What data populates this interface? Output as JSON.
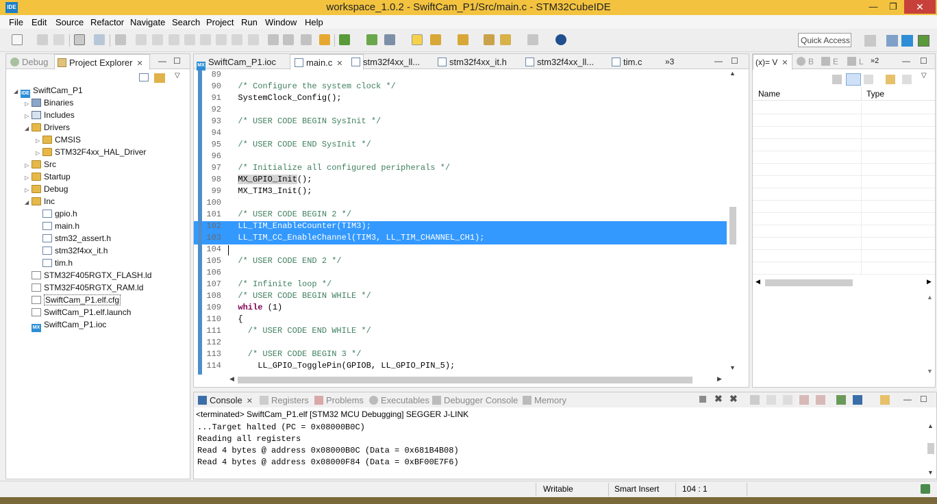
{
  "window": {
    "title": "workspace_1.0.2 - SwiftCam_P1/Src/main.c - STM32CubeIDE",
    "app_icon_text": "IDE",
    "min_glyph": "—",
    "max_glyph": "❐",
    "close_glyph": "✕"
  },
  "menu": [
    "File",
    "Edit",
    "Source",
    "Refactor",
    "Navigate",
    "Search",
    "Project",
    "Run",
    "Window",
    "Help"
  ],
  "toolbar": {
    "quick_access": "Quick Access"
  },
  "left_panel": {
    "tabs": [
      {
        "label": "Debug",
        "icon": "debug-icon"
      },
      {
        "label": "Project Explorer",
        "icon": "project-explorer-icon",
        "close": "✕"
      }
    ],
    "tree": [
      {
        "label": "SwiftCam_P1",
        "icon": "project-icon",
        "arrow": "◢"
      },
      {
        "label": "Binaries",
        "icon": "binaries-icon",
        "arrow": "▷"
      },
      {
        "label": "Includes",
        "icon": "includes-icon",
        "arrow": "▷"
      },
      {
        "label": "Drivers",
        "icon": "folder-icon",
        "arrow": "◢"
      },
      {
        "label": "CMSIS",
        "icon": "folder-icon",
        "arrow": "▷"
      },
      {
        "label": "STM32F4xx_HAL_Driver",
        "icon": "folder-icon",
        "arrow": "▷"
      },
      {
        "label": "Src",
        "icon": "folder-icon",
        "arrow": "▷"
      },
      {
        "label": "Startup",
        "icon": "folder-icon",
        "arrow": "▷"
      },
      {
        "label": "Debug",
        "icon": "folder-icon",
        "arrow": "▷"
      },
      {
        "label": "Inc",
        "icon": "folder-icon",
        "arrow": "◢"
      },
      {
        "label": "gpio.h",
        "icon": "header-file-icon",
        "arrow": ""
      },
      {
        "label": "main.h",
        "icon": "header-file-icon",
        "arrow": ""
      },
      {
        "label": "stm32_assert.h",
        "icon": "header-file-icon",
        "arrow": ""
      },
      {
        "label": "stm32f4xx_it.h",
        "icon": "header-file-icon",
        "arrow": ""
      },
      {
        "label": "tim.h",
        "icon": "header-file-icon",
        "arrow": ""
      },
      {
        "label": "STM32F405RGTX_FLASH.ld",
        "icon": "linker-file-icon",
        "arrow": ""
      },
      {
        "label": "STM32F405RGTX_RAM.ld",
        "icon": "linker-file-icon",
        "arrow": ""
      },
      {
        "label": "SwiftCam_P1.elf.cfg",
        "icon": "cfg-file-icon",
        "arrow": ""
      },
      {
        "label": "SwiftCam_P1.elf.launch",
        "icon": "launch-file-icon",
        "arrow": ""
      },
      {
        "label": "SwiftCam_P1.ioc",
        "icon": "ioc-file-icon",
        "arrow": ""
      }
    ]
  },
  "editor": {
    "tabs": [
      {
        "label": "SwiftCam_P1.ioc",
        "icon": "ioc-file-icon"
      },
      {
        "label": "main.c",
        "icon": "c-file-icon",
        "close": "✕"
      },
      {
        "label": "stm32f4xx_ll...",
        "icon": "header-file-icon"
      },
      {
        "label": "stm32f4xx_it.h",
        "icon": "header-file-icon"
      },
      {
        "label": "stm32f4xx_ll...",
        "icon": "header-file-icon"
      },
      {
        "label": "tim.c",
        "icon": "c-file-icon"
      }
    ],
    "overflow_tabs": "»3",
    "lines": [
      {
        "n": "89",
        "t": "",
        "kind": ""
      },
      {
        "n": "90",
        "t": "  /* Configure the system clock */",
        "kind": "cmt"
      },
      {
        "n": "91",
        "t": "  SystemClock_Config();",
        "kind": ""
      },
      {
        "n": "92",
        "t": "",
        "kind": ""
      },
      {
        "n": "93",
        "t": "  /* USER CODE BEGIN SysInit */",
        "kind": "cmt"
      },
      {
        "n": "94",
        "t": "",
        "kind": ""
      },
      {
        "n": "95",
        "t": "  /* USER CODE END SysInit */",
        "kind": "cmt"
      },
      {
        "n": "96",
        "t": "",
        "kind": ""
      },
      {
        "n": "97",
        "t": "  /* Initialize all configured peripherals */",
        "kind": "cmt"
      },
      {
        "n": "98",
        "t": "  MX_GPIO_Init();",
        "kind": "hlcall"
      },
      {
        "n": "99",
        "t": "  MX_TIM3_Init();",
        "kind": ""
      },
      {
        "n": "100",
        "t": "",
        "kind": ""
      },
      {
        "n": "101",
        "t": "  /* USER CODE BEGIN 2 */",
        "kind": "cmt"
      },
      {
        "n": "102",
        "t": "  LL_TIM_EnableCounter(TIM3);",
        "kind": "sel"
      },
      {
        "n": "103",
        "t": "  LL_TIM_CC_EnableChannel(TIM3, LL_TIM_CHANNEL_CH1);",
        "kind": "sel"
      },
      {
        "n": "104",
        "t": "",
        "kind": "cursor"
      },
      {
        "n": "105",
        "t": "  /* USER CODE END 2 */",
        "kind": "cmt"
      },
      {
        "n": "106",
        "t": "",
        "kind": ""
      },
      {
        "n": "107",
        "t": "  /* Infinite loop */",
        "kind": "cmt"
      },
      {
        "n": "108",
        "t": "  /* USER CODE BEGIN WHILE */",
        "kind": "cmt"
      },
      {
        "n": "109",
        "t": "  while (1)",
        "kind": "kwline"
      },
      {
        "n": "110",
        "t": "  {",
        "kind": ""
      },
      {
        "n": "111",
        "t": "    /* USER CODE END WHILE */",
        "kind": "cmt"
      },
      {
        "n": "112",
        "t": "",
        "kind": ""
      },
      {
        "n": "113",
        "t": "    /* USER CODE BEGIN 3 */",
        "kind": "cmt"
      },
      {
        "n": "114",
        "t": "      LL_GPIO_TogglePin(GPIOB, LL_GPIO_PIN_5);",
        "kind": ""
      }
    ]
  },
  "right_panel": {
    "tabs": [
      {
        "label": "(x)= V",
        "close": "✕"
      },
      {
        "label": "B"
      },
      {
        "label": "E"
      },
      {
        "label": "L"
      },
      {
        "label": "»2"
      }
    ],
    "columns": [
      "Name",
      "Type"
    ]
  },
  "console": {
    "tabs": [
      {
        "label": "Console",
        "icon": "console-icon",
        "close": "✕"
      },
      {
        "label": "Registers",
        "icon": "registers-icon"
      },
      {
        "label": "Problems",
        "icon": "problems-icon"
      },
      {
        "label": "Executables",
        "icon": "executables-icon"
      },
      {
        "label": "Debugger Console",
        "icon": "debugger-console-icon"
      },
      {
        "label": "Memory",
        "icon": "memory-icon"
      }
    ],
    "session": "<terminated> SwiftCam_P1.elf [STM32 MCU Debugging] SEGGER J-LINK",
    "lines": [
      "...Target halted (PC = 0x08000B0C)",
      "Reading all registers",
      "Read 4 bytes @ address 0x08000B0C (Data = 0x681B4B08)",
      "Read 4 bytes @ address 0x08000F84 (Data = 0xBF00E7F6)"
    ]
  },
  "status": {
    "writable": "Writable",
    "insert_mode": "Smart Insert",
    "position": "104 : 1"
  },
  "colors": {
    "titlebar": "#f3c340",
    "selection": "#3399ff",
    "comment": "#3f7f5f",
    "keyword": "#7f0055"
  }
}
